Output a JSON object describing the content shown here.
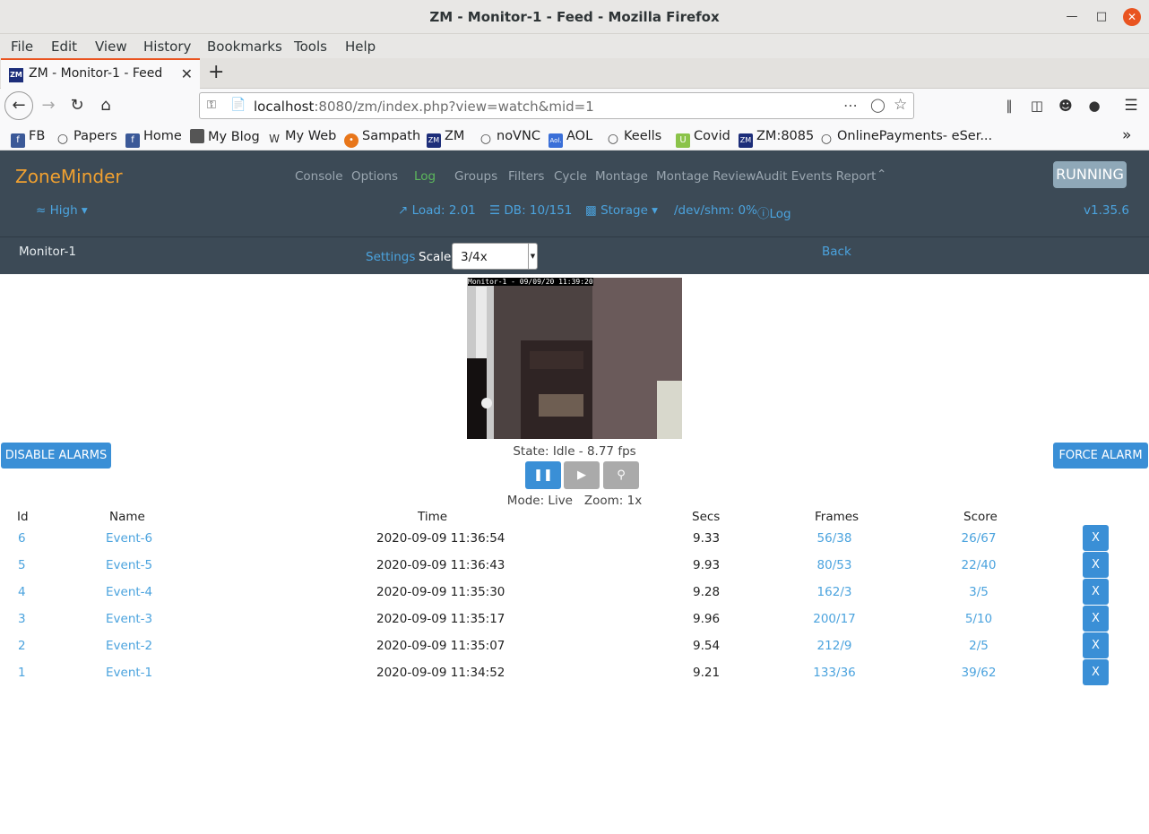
{
  "window": {
    "title": "ZM - Monitor-1 - Feed - Mozilla Firefox"
  },
  "menubar": [
    "File",
    "Edit",
    "View",
    "History",
    "Bookmarks",
    "Tools",
    "Help"
  ],
  "tab": {
    "title": "ZM - Monitor-1 - Feed",
    "favicon": "ZM"
  },
  "address": {
    "host": "localhost",
    "rest": ":8080/zm/index.php?view=watch&mid=1"
  },
  "bookmarks": [
    "FB",
    "Papers",
    "Home",
    "My Blog",
    "My Web",
    "Sampath",
    "ZM",
    "noVNC",
    "AOL",
    "Keells",
    "Covid",
    "ZM:8085",
    "OnlinePayments- eSer..."
  ],
  "zm": {
    "brand": "ZoneMinder",
    "nav": [
      "Console",
      "Options",
      "Log",
      "Groups",
      "Filters",
      "Cycle",
      "Montage",
      "Montage Review",
      "Audit Events Report"
    ],
    "running": "RUNNING",
    "bandwidth": "High",
    "load": "Load: 2.01",
    "db": "DB: 10/151",
    "storage": "Storage",
    "shm": "/dev/shm: 0%",
    "log": "Log",
    "version": "v1.35.6",
    "colors": {
      "header": "#3c4a56",
      "brand": "#f0a030",
      "link": "#4ba3de",
      "button": "#3a8fd6",
      "log_active": "#5cb85c"
    }
  },
  "monitor": {
    "name": "Monitor-1",
    "settings": "Settings",
    "scale_label": "Scale:",
    "scale_value": "3/4x",
    "back": "Back",
    "overlay": "Monitor-1 - 09/09/20 11:39:20",
    "state": "State: Idle - 8.77 fps",
    "mode": "Mode: Live   Zoom: 1x",
    "disable_alarms": "DISABLE ALARMS",
    "force_alarm": "FORCE ALARM"
  },
  "events": {
    "headers": [
      "Id",
      "Name",
      "Time",
      "Secs",
      "Frames",
      "Score"
    ],
    "rows": [
      {
        "id": "6",
        "name": "Event-6",
        "time": "2020-09-09 11:36:54",
        "secs": "9.33",
        "frames": "56/38",
        "score": "26/67"
      },
      {
        "id": "5",
        "name": "Event-5",
        "time": "2020-09-09 11:36:43",
        "secs": "9.93",
        "frames": "80/53",
        "score": "22/40"
      },
      {
        "id": "4",
        "name": "Event-4",
        "time": "2020-09-09 11:35:30",
        "secs": "9.28",
        "frames": "162/3",
        "score": "3/5"
      },
      {
        "id": "3",
        "name": "Event-3",
        "time": "2020-09-09 11:35:17",
        "secs": "9.96",
        "frames": "200/17",
        "score": "5/10"
      },
      {
        "id": "2",
        "name": "Event-2",
        "time": "2020-09-09 11:35:07",
        "secs": "9.54",
        "frames": "212/9",
        "score": "2/5"
      },
      {
        "id": "1",
        "name": "Event-1",
        "time": "2020-09-09 11:34:52",
        "secs": "9.21",
        "frames": "133/36",
        "score": "39/62"
      }
    ],
    "delete_label": "X"
  }
}
